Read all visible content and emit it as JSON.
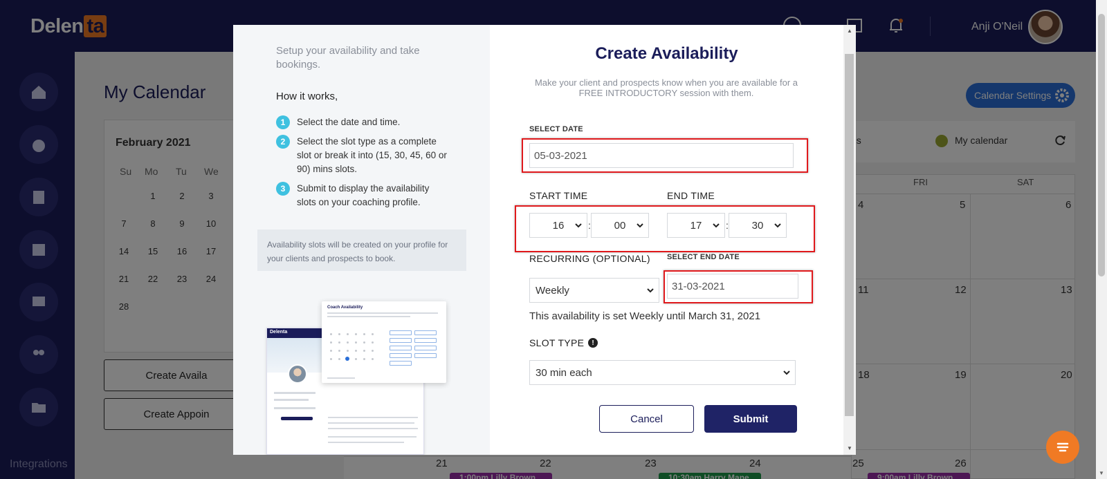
{
  "app": {
    "logo_main": "Delen",
    "logo_accent": "ta",
    "user_name": "Anji O'Neil",
    "sidebar_footer": "Integrations",
    "accent": "#f07a24",
    "brand": "#1b1d5a"
  },
  "calendar_page": {
    "title": "My Calendar",
    "month": "February 2021",
    "weekdays": [
      "Su",
      "Mo",
      "Tu",
      "We"
    ],
    "days": [
      "1",
      "2",
      "3",
      "7",
      "8",
      "9",
      "10",
      "14",
      "15",
      "16",
      "17",
      "21",
      "22",
      "23",
      "24",
      "28"
    ],
    "actions": [
      "Create Availa",
      "Create Appoin"
    ],
    "settings_button": "Calendar Settings",
    "legend_cut": "ns",
    "legend_label": "My calendar",
    "col_fri": "FRI",
    "col_sat": "SAT",
    "grid_numbers": [
      "4",
      "5",
      "6",
      "11",
      "12",
      "13",
      "18",
      "19",
      "20"
    ],
    "bottom_numbers": [
      "21",
      "22",
      "23",
      "24",
      "25",
      "26"
    ],
    "events": [
      "1:00pm Lilly Brown",
      "10:30am Harry Mane",
      "9:00am Lilly Brown"
    ]
  },
  "modal": {
    "intro": "Setup your availability and take bookings.",
    "how_title": "How it works,",
    "steps": [
      {
        "num": "1",
        "text": "Select the date and time."
      },
      {
        "num": "2",
        "text": "Select the slot type as a complete slot or break it into (15, 30, 45, 60 or 90) mins slots."
      },
      {
        "num": "3",
        "text": "Submit to display the availability slots on your coaching profile."
      }
    ],
    "note": "Availability slots will be created on your profile for your clients and prospects to book.",
    "illustration": {
      "card_title": "Coach Availability",
      "logo": "Delenta"
    },
    "title": "Create Availability",
    "subtitle": "Make your client and prospects know when you are available for a FREE INTRODUCTORY session with them.",
    "select_date_label": "SELECT DATE",
    "select_date_value": "05-03-2021",
    "start_time_label": "START TIME",
    "end_time_label": "END TIME",
    "start_hour": "16",
    "start_min": "00",
    "end_hour": "17",
    "end_min": "30",
    "colon": ":",
    "recurring_label": "RECURRING (OPTIONAL)",
    "recurring_value": "Weekly",
    "end_date_label": "SELECT END DATE",
    "end_date_value": "31-03-2021",
    "info_line": "This availability is set Weekly until March 31, 2021",
    "slot_type_label": "SLOT TYPE",
    "slot_type_value": "30 min each",
    "cancel": "Cancel",
    "submit": "Submit"
  }
}
